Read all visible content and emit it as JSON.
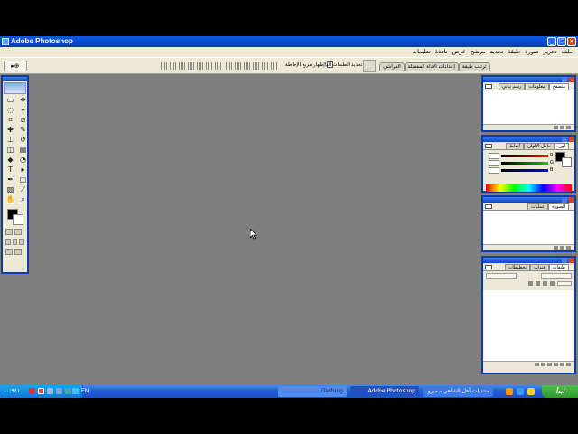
{
  "window": {
    "title": "Adobe Photoshop"
  },
  "menubar": {
    "items": [
      "ملف",
      "تحرير",
      "صورة",
      "طبقة",
      "تحديد",
      "مرشح",
      "عرض",
      "نافذة",
      "تعليمات"
    ]
  },
  "options_bar": {
    "tool_preset_label": "▸⊕",
    "auto_select_label": "تحديد الطبقات آليا",
    "show_bounds_label": "إظهار مربع الإحاطة",
    "tabs": [
      "ترتيب طبقة",
      "إعدادات الأداة المفضلة",
      "الفراشي"
    ]
  },
  "palettes": {
    "navigator": {
      "tabs": [
        "متصفح",
        "معلومات",
        "رسم بياني"
      ]
    },
    "color": {
      "tabs": [
        "لون",
        "حامل الألوان",
        "أنماط"
      ],
      "channels": [
        "R",
        "G",
        "B"
      ]
    },
    "history": {
      "tabs": [
        "الصورة",
        "عمليات"
      ]
    },
    "layers": {
      "tabs": [
        "طبقات",
        "قنوات",
        "تخطيطات"
      ]
    }
  },
  "taskbar": {
    "start_label": "ابدأ",
    "language": "EN",
    "clock": "٠٠:٩٤١",
    "tasks": [
      {
        "label": "منتديات أهل الشاهي - ميرو"
      },
      {
        "label": "Adobe Photoshop"
      },
      {
        "label": "Flashing"
      }
    ]
  },
  "colors": {
    "titlebar": "#0b46c8",
    "workspace": "#7f7f7f",
    "panel": "#ece9d8",
    "taskbar": "#245edb",
    "start": "#2f9a2e"
  }
}
